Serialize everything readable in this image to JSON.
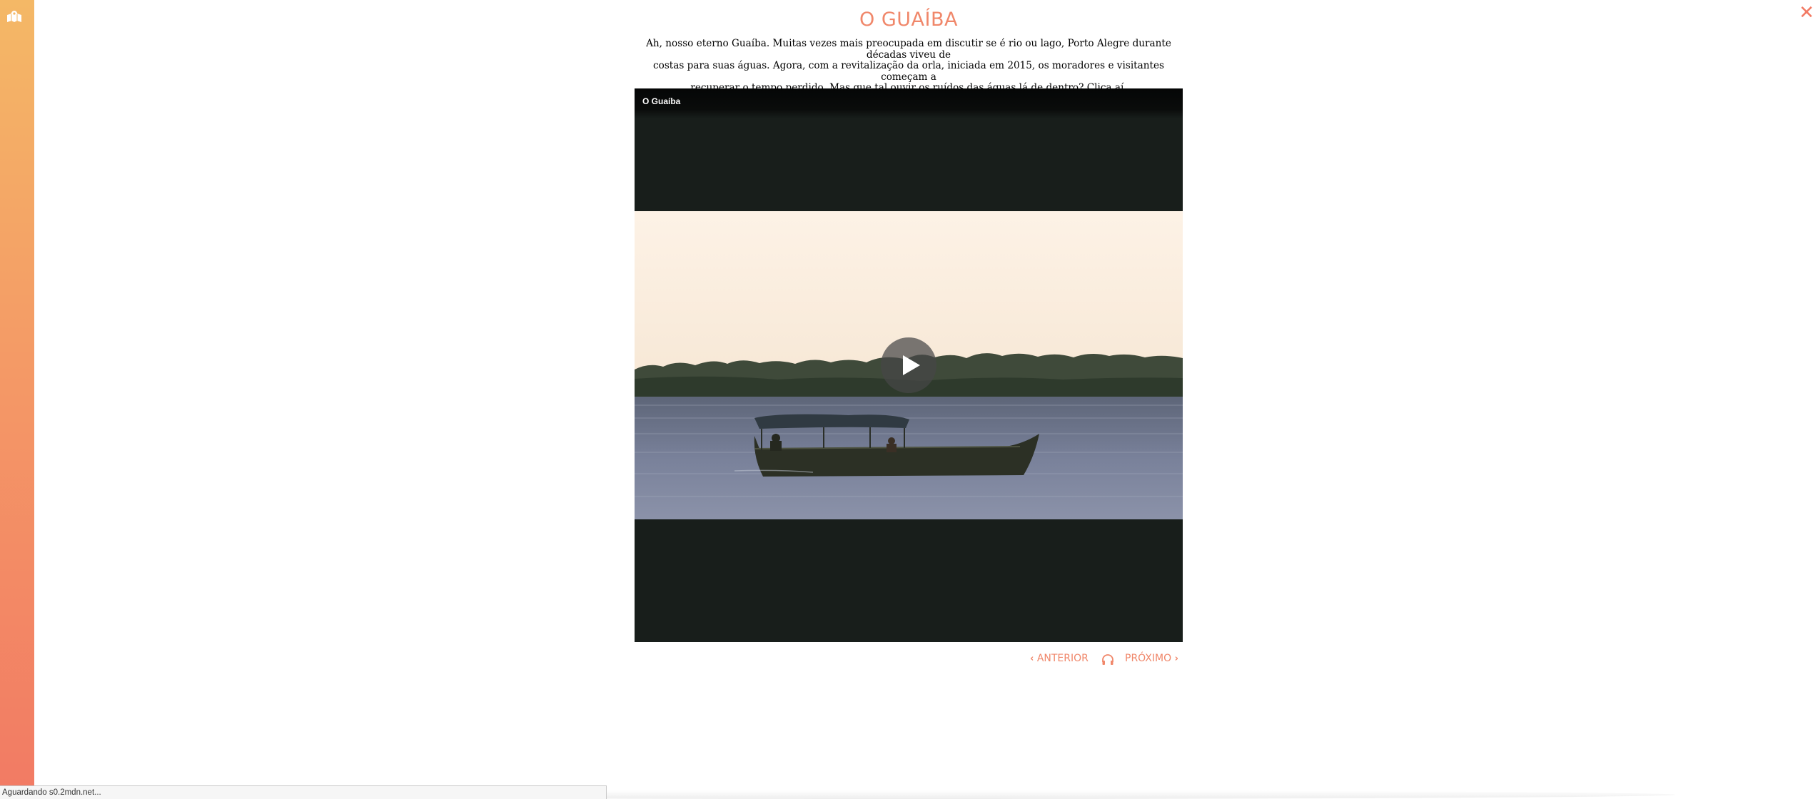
{
  "sidebar": {
    "map_icon": "map-icon",
    "gradient_colors": [
      "#f4b866",
      "#f27a64"
    ]
  },
  "close_icon": "close-icon",
  "article": {
    "title": "O GUAÍBA",
    "description_lines": [
      "Ah, nosso eterno Guaíba. Muitas vezes mais preocupada em discutir se é rio ou lago, Porto Alegre durante décadas viveu de",
      "costas para suas águas. Agora, com a revitalização da orla, iniciada em 2015, os moradores e visitantes começam a",
      "recuperar o tempo perdido. Mas que tal ouvir os ruídos das águas lá de dentro? Clica aí."
    ]
  },
  "video": {
    "title": "O Guaíba",
    "play_icon": "play-icon"
  },
  "navigation": {
    "prev_label": "ANTERIOR",
    "next_label": "PRÓXIMO",
    "prev_icon": "chevron-left-icon",
    "next_icon": "chevron-right-icon",
    "audio_icon": "headphones-icon"
  },
  "status_bar": {
    "text": "Aguardando s0.2mdn.net..."
  },
  "colors": {
    "accent": "#f0876a",
    "video_background": "#181e1b"
  }
}
